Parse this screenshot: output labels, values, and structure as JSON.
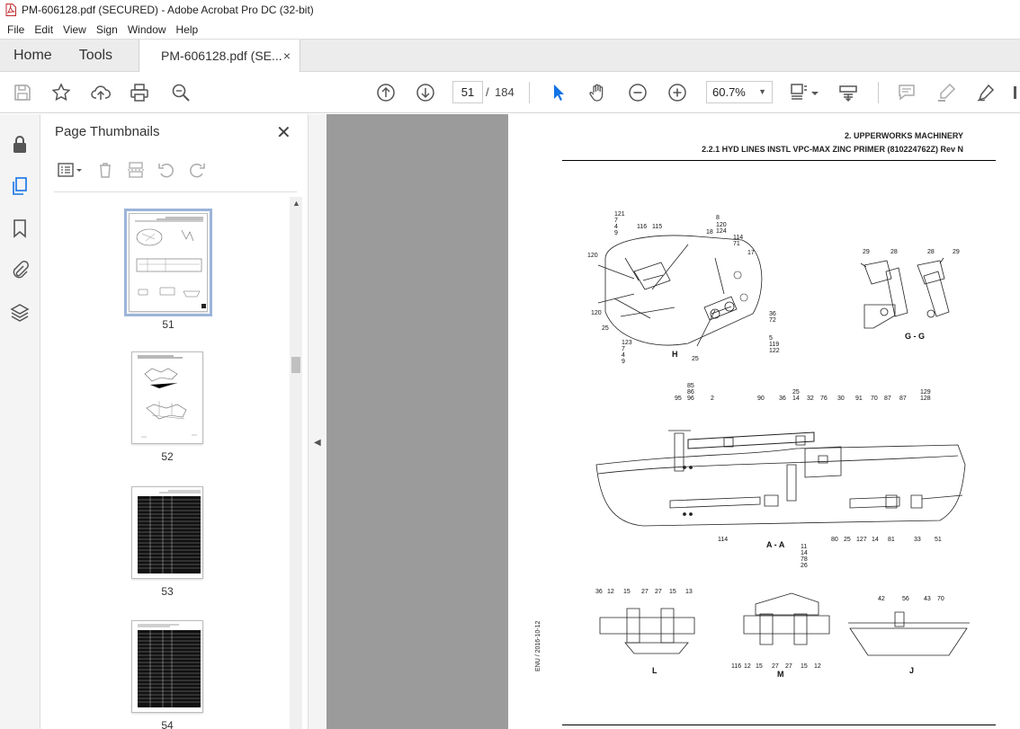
{
  "window": {
    "title": "PM-606128.pdf (SECURED) - Adobe Acrobat Pro DC (32-bit)"
  },
  "menu": [
    "File",
    "Edit",
    "View",
    "Sign",
    "Window",
    "Help"
  ],
  "tabs": {
    "home": "Home",
    "tools": "Tools",
    "document": "PM-606128.pdf (SE...",
    "close_glyph": "×"
  },
  "toolbar": {
    "current_page": "51",
    "page_separator": "/",
    "total_pages": "184",
    "zoom": "60.7%",
    "icons": [
      "save-icon",
      "bookmark-star-icon",
      "upload-icon",
      "print-icon",
      "search-zoom-icon",
      "page-up-icon",
      "page-down-icon",
      "select-cursor-icon",
      "hand-icon",
      "zoom-out-icon",
      "zoom-in-icon",
      "page-fit-icon",
      "scroll-mode-icon",
      "comment-icon",
      "highlight-icon",
      "sign-icon"
    ]
  },
  "left_rail": [
    "lock-icon",
    "page-thumbnails-icon",
    "bookmarks-icon",
    "attachments-icon",
    "layers-icon"
  ],
  "thumbnail_panel": {
    "title": "Page Thumbnails",
    "close_glyph": "✕",
    "pages": [
      {
        "label": "51",
        "selected": true
      },
      {
        "label": "52",
        "selected": false
      },
      {
        "label": "53",
        "selected": false
      },
      {
        "label": "54",
        "selected": false
      }
    ]
  },
  "document": {
    "header_line1": "2. UPPERWORKS MACHINERY",
    "header_line2": "2.2.1 HYD LINES INSTL VPC-MAX ZINC PRIMER (810224762Z) Rev N",
    "side_stamp": "ENU / 2016-10-12",
    "view_labels": {
      "h": "H",
      "gg": "G - G",
      "aa": "A - A",
      "l": "L",
      "m": "M",
      "j": "J"
    },
    "callouts_h": [
      "121",
      "7",
      "4",
      "9",
      "116",
      "115",
      "8",
      "120",
      "124",
      "18",
      "114",
      "71",
      "17",
      "120",
      "120",
      "25",
      "36",
      "72",
      "5",
      "119",
      "122",
      "123",
      "7",
      "4",
      "9",
      "25"
    ],
    "callouts_gg": [
      "29",
      "28",
      "28",
      "29"
    ],
    "callouts_aa_top": [
      "85",
      "86",
      "96",
      "95",
      "2",
      "90",
      "36",
      "25",
      "14",
      "32",
      "76",
      "30",
      "91",
      "70",
      "87",
      "87",
      "129",
      "128"
    ],
    "callouts_aa_bottom": [
      "114",
      "11",
      "14",
      "78",
      "26",
      "80",
      "25",
      "127",
      "14",
      "81",
      "33",
      "51"
    ],
    "callouts_l": [
      "36",
      "12",
      "15",
      "27",
      "27",
      "15",
      "13"
    ],
    "callouts_m": [
      "116",
      "12",
      "15",
      "27",
      "27",
      "15",
      "12"
    ],
    "callouts_j": [
      "42",
      "56",
      "43",
      "70"
    ]
  },
  "colors": {
    "accent": "#1473e6",
    "doc_background": "#9b9b9b",
    "selection_outline": "#9cb4d8"
  }
}
